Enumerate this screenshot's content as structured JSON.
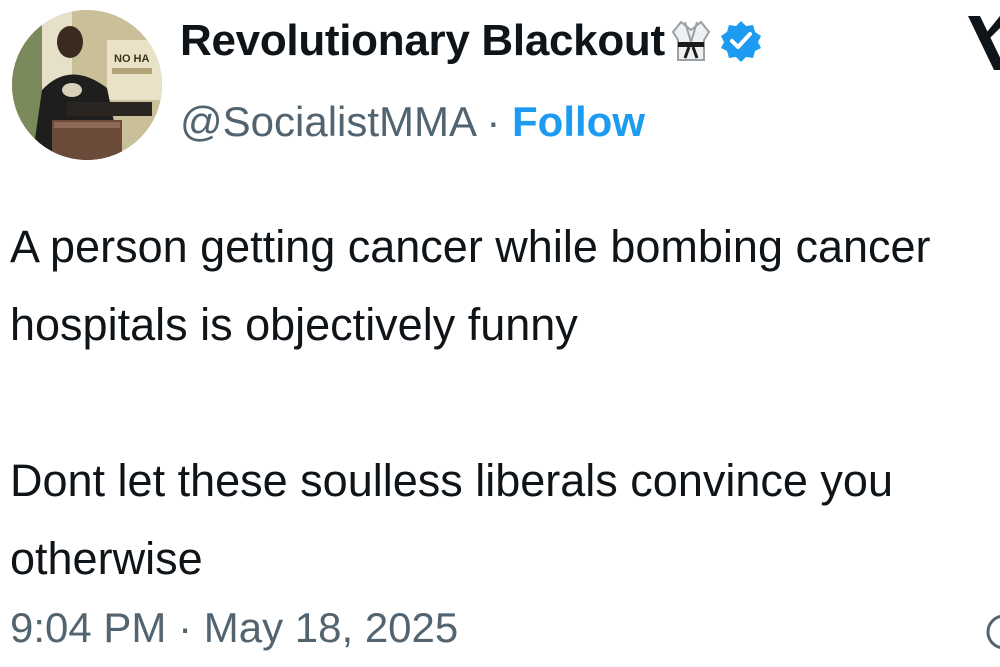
{
  "author": {
    "display_name": "Revolutionary Blackout",
    "handle": "@SocialistMMA",
    "separator": " · ",
    "follow_label": "Follow",
    "avatar_sign_text": "NO HA",
    "badge_icons": [
      "gi-icon",
      "verified-icon"
    ]
  },
  "tweet": {
    "text": "A person getting cancer while bombing cancer hospitals is objectively funny\n\nDont let these soulless liberals convince you otherwise",
    "time": "9:04 PM",
    "separator": " · ",
    "date": "May 18, 2025"
  },
  "colors": {
    "text": "#0f1419",
    "secondary": "#536471",
    "accent": "#1d9bf0"
  },
  "icons": [
    "x-logo-icon",
    "info-icon"
  ]
}
